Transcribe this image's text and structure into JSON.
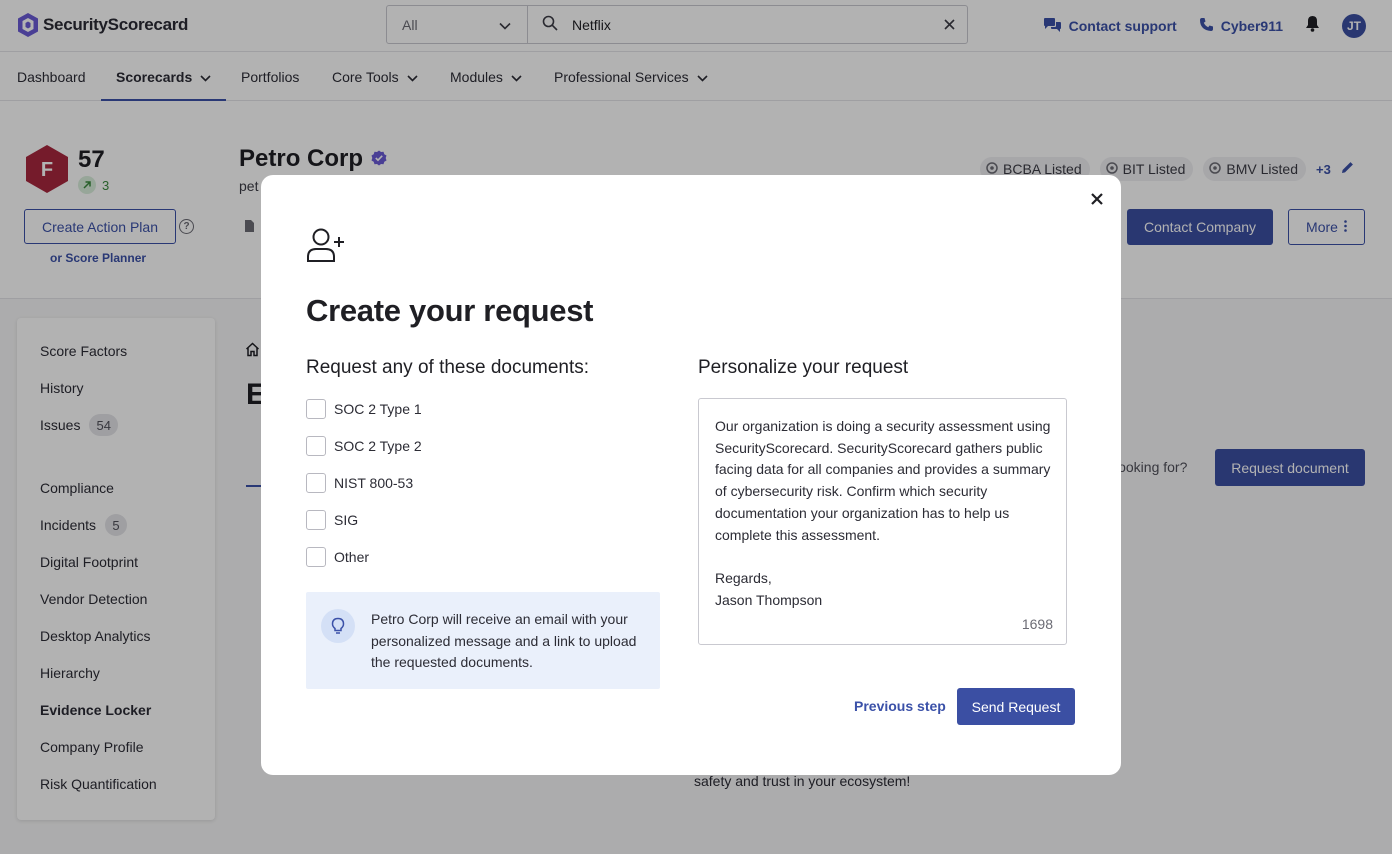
{
  "brand": {
    "name": "SecurityScorecard",
    "accent": "#3b51a8",
    "grade_color": "#a8283e"
  },
  "search": {
    "scope": "All",
    "query": "Netflix"
  },
  "top_links": {
    "contact_support": "Contact support",
    "cyber911": "Cyber911",
    "avatar_initials": "JT"
  },
  "nav": {
    "items": [
      {
        "label": "Dashboard"
      },
      {
        "label": "Scorecards"
      },
      {
        "label": "Portfolios"
      },
      {
        "label": "Core Tools"
      },
      {
        "label": "Modules"
      },
      {
        "label": "Professional Services"
      }
    ]
  },
  "company": {
    "grade": "F",
    "score": "57",
    "trend": "3",
    "name": "Petro Corp",
    "domain_partial": "pet",
    "create_action_plan": "Create Action Plan",
    "score_planner": "or Score Planner",
    "tags": [
      "BCBA Listed",
      "BIT Listed",
      "BMV Listed"
    ],
    "tags_more": "+3",
    "contact_company": "Contact Company",
    "more": "More"
  },
  "sidebar": {
    "items": [
      {
        "label": "Score Factors"
      },
      {
        "label": "History"
      },
      {
        "label": "Issues",
        "badge": "54"
      },
      {
        "label": "Compliance"
      },
      {
        "label": "Incidents",
        "badge": "5"
      },
      {
        "label": "Digital Footprint"
      },
      {
        "label": "Vendor Detection"
      },
      {
        "label": "Desktop Analytics"
      },
      {
        "label": "Hierarchy"
      },
      {
        "label": "Evidence Locker"
      },
      {
        "label": "Company Profile"
      },
      {
        "label": "Risk Quantification"
      }
    ]
  },
  "main": {
    "title_partial": "E",
    "looking_for": "looking for?",
    "request_document": "Request document",
    "footer_text": "safety and trust in your ecosystem!"
  },
  "modal": {
    "title": "Create your request",
    "docs_heading": "Request any of these documents:",
    "documents": [
      "SOC 2 Type 1",
      "SOC 2 Type 2",
      "NIST 800-53",
      "SIG",
      "Other"
    ],
    "info_text": "Petro Corp will receive an email with your personalized message and a link to upload the requested documents.",
    "personalize_heading": "Personalize your request",
    "message": "Our organization is doing a security assessment using SecurityScorecard. SecurityScorecard gathers public facing data for all companies and provides a summary of cybersecurity risk. Confirm which security documentation your organization has to help us complete this assessment.\n\nRegards,\nJason Thompson",
    "char_count": "1698",
    "previous_step": "Previous step",
    "send_request": "Send Request"
  }
}
